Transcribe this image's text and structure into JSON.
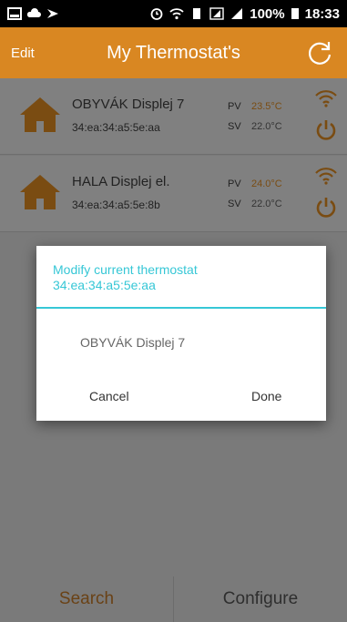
{
  "status_bar": {
    "battery": "100%",
    "time": "18:33"
  },
  "app_bar": {
    "edit_label": "Edit",
    "title": "My Thermostat's"
  },
  "thermostats": [
    {
      "name": "OBYVÁK Displej 7",
      "mac": "34:ea:34:a5:5e:aa",
      "pv_label": "PV",
      "pv_value": "23.5°C",
      "sv_label": "SV",
      "sv_value": "22.0°C"
    },
    {
      "name": "HALA Displej el.",
      "mac": "34:ea:34:a5:5e:8b",
      "pv_label": "PV",
      "pv_value": "24.0°C",
      "sv_label": "SV",
      "sv_value": "22.0°C"
    }
  ],
  "dialog": {
    "heading_line1": "Modify current thermostat",
    "heading_line2": "34:ea:34:a5:5e:aa",
    "name_value": "OBYVÁK Displej 7",
    "cancel_label": "Cancel",
    "done_label": "Done"
  },
  "tabs": {
    "search_label": "Search",
    "configure_label": "Configure"
  },
  "colors": {
    "accent": "#d98722",
    "dialog_accent": "#36c7d6"
  }
}
